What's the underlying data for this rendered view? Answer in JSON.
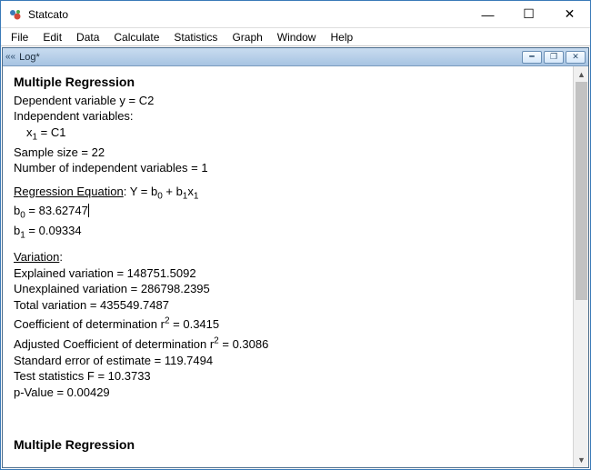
{
  "window": {
    "title": "Statcato",
    "controls": {
      "min": "—",
      "max": "☐",
      "close": "✕"
    }
  },
  "menu": {
    "file": "File",
    "edit": "Edit",
    "data": "Data",
    "calculate": "Calculate",
    "statistics": "Statistics",
    "graph": "Graph",
    "window": "Window",
    "help": "Help"
  },
  "logWindow": {
    "glyph": "««",
    "title": "Log*",
    "controls": {
      "min": "━",
      "max": "❐",
      "close": "✕"
    }
  },
  "content": {
    "heading1": "Multiple Regression",
    "depVarLabel": "Dependent variable y = ",
    "depVar": "C2",
    "indepVarsLabel": "Independent variables:",
    "x1Label": "x",
    "x1Sub": "1",
    "x1Eq": " = ",
    "x1Val": "C1",
    "sampleSizeLabel": "Sample size = ",
    "sampleSize": "22",
    "numIndepLabel": "Number of independent variables = ",
    "numIndep": "1",
    "regEqLabel": "Regression Equation",
    "regEqSep": ": Y = b",
    "regEqSub0": "0",
    "regEqPlus": " + b",
    "regEqSub1": "1",
    "regEqX": "x",
    "regEqXSub": "1",
    "b0Label": "b",
    "b0Sub": "0",
    "b0Eq": " = ",
    "b0Val": "83.62747",
    "b1Label": "b",
    "b1Sub": "1",
    "b1Eq": " = ",
    "b1Val": "0.09334",
    "variationLabel": "Variation",
    "variationColon": ":",
    "explVarLabel": "Explained variation = ",
    "explVar": "148751.5092",
    "unexplVarLabel": "Unexplained variation = ",
    "unexplVar": "286798.2395",
    "totalVarLabel": "Total variation = ",
    "totalVar": "435549.7487",
    "r2Label": "Coefficient of determination r",
    "r2Sup": "2",
    "r2Eq": " = ",
    "r2Val": "0.3415",
    "adjR2Label": "Adjusted Coefficient of determination r",
    "adjR2Sup": "2",
    "adjR2Eq": " = ",
    "adjR2Val": "0.3086",
    "seLabel": "Standard error of estimate = ",
    "seVal": "119.7494",
    "fLabel": "Test statistics F = ",
    "fVal": "10.3733",
    "pLabel": "p-Value = ",
    "pVal": "0.00429",
    "heading2": "Multiple Regression"
  }
}
